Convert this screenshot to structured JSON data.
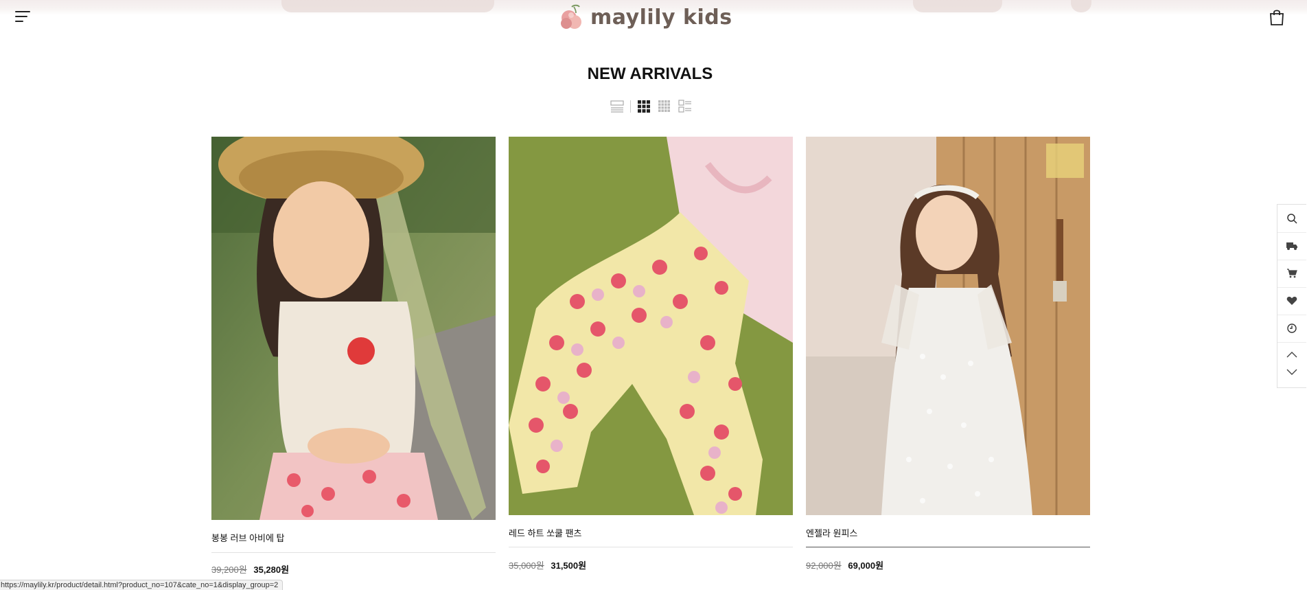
{
  "header": {
    "logo_text": "maylily kids",
    "menu_icon": "menu-icon",
    "cart_icon": "shopping-bag-icon"
  },
  "page": {
    "title": "NEW ARRIVALS"
  },
  "view_modes": [
    {
      "name": "list-view-icon",
      "active": false
    },
    {
      "name": "grid-2-view-icon",
      "active": true
    },
    {
      "name": "grid-4-view-icon",
      "active": false
    },
    {
      "name": "detail-list-view-icon",
      "active": false
    }
  ],
  "products": [
    {
      "name": "봉봉 러브 아비에 탑",
      "original_price": "39,200원",
      "sale_price": "35,280원"
    },
    {
      "name": "레드 하트 쏘쿨 팬츠",
      "original_price": "35,000원",
      "sale_price": "31,500원"
    },
    {
      "name": "엔젤라 원피스",
      "original_price": "92,000원",
      "sale_price": "69,000원"
    }
  ],
  "side_bar": [
    "search-icon",
    "delivery-truck-icon",
    "cart-icon",
    "heart-icon",
    "recent-clock-icon",
    "scroll-up-icon",
    "scroll-down-icon"
  ],
  "status_bar": {
    "url": "https://maylily.kr/product/detail.html?product_no=107&cate_no=1&display_group=2"
  },
  "colors": {
    "logo_text": "#6e5f57",
    "logo_flower": "#e9a0a0",
    "accent_dark": "#111111"
  }
}
